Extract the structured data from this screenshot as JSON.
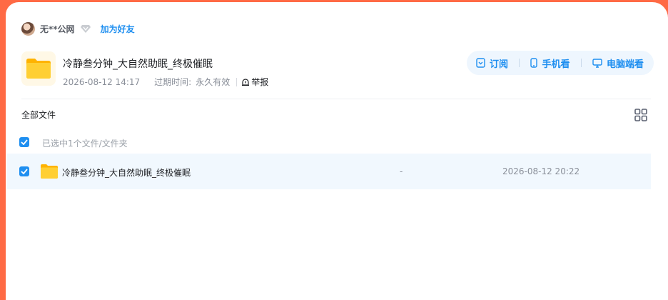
{
  "user": {
    "name": "无**公网",
    "add_friend": "加为好友"
  },
  "share": {
    "title": "冷静叁分钟_大自然助眠_终极催眠",
    "created": "2026-08-12 14:17",
    "expire_label": "过期时间:",
    "expire_value": "永久有效",
    "report": "举报"
  },
  "actions": {
    "subscribe": "订阅",
    "mobile": "手机看",
    "desktop": "电脑端看"
  },
  "toolbar": {
    "all_files": "全部文件"
  },
  "selection": {
    "info": "已选中1个文件/文件夹",
    "checked": true
  },
  "files": [
    {
      "name": "冷静叁分钟_大自然助眠_终极催眠",
      "size": "-",
      "date": "2026-08-12 20:22",
      "checked": true
    }
  ],
  "colors": {
    "accent": "#1f8ff0",
    "frame": "#ff6a45",
    "row_highlight": "#f1f8fe",
    "folder": "#ffc61a"
  }
}
